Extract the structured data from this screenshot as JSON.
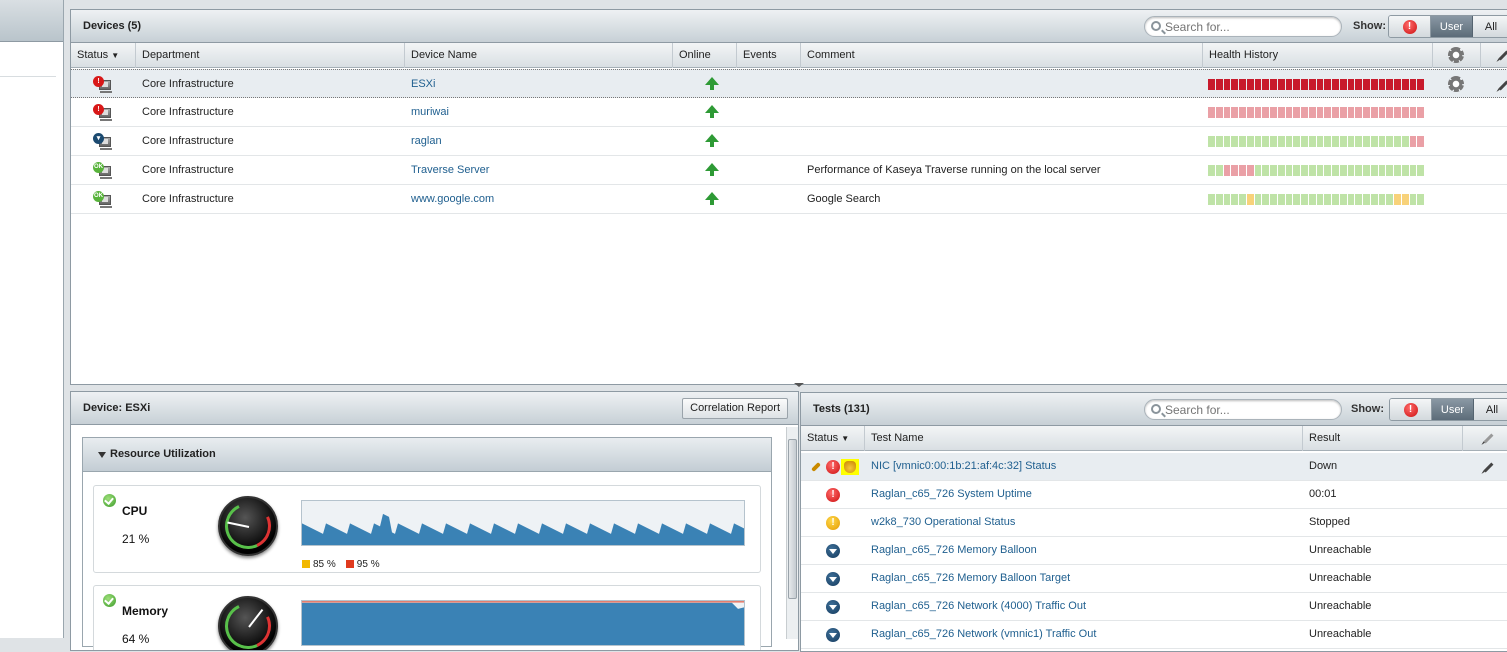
{
  "devices_panel": {
    "title": "Devices (5)",
    "search_placeholder": "Search for...",
    "show_label": "Show:",
    "show_user": "User",
    "show_all": "All",
    "columns": {
      "status": "Status",
      "department": "Department",
      "device_name": "Device Name",
      "online": "Online",
      "events": "Events",
      "comment": "Comment",
      "health_history": "Health History"
    },
    "rows": [
      {
        "status": "critical",
        "department": "Core Infrastructure",
        "device": "ESXi",
        "comment": "",
        "health": "rrrrrrrrrrrrrrrrrrrrrrrrrrrr"
      },
      {
        "status": "critical",
        "department": "Core Infrastructure",
        "device": "muriwai",
        "comment": "",
        "health": "pppppppppppppppppppppppppppp"
      },
      {
        "status": "unreachable",
        "department": "Core Infrastructure",
        "device": "raglan",
        "comment": "",
        "health": "ggggggggggggggggggggggggggpp"
      },
      {
        "status": "ok",
        "department": "Core Infrastructure",
        "device": "Traverse Server",
        "comment": "Performance of Kaseya Traverse running on the local server",
        "health": "ggppppgggggggggggggggggggggg"
      },
      {
        "status": "ok",
        "department": "Core Infrastructure",
        "device": "www.google.com",
        "comment": "Google Search",
        "health": "gggggyggggggggggggggggggyygg"
      }
    ]
  },
  "device_panel": {
    "title": "Device: ESXi",
    "correlation_button": "Correlation Report",
    "resource_title": "Resource Utilization",
    "cpu": {
      "name": "CPU",
      "value": "21 %",
      "fraction": 0.21
    },
    "memory": {
      "name": "Memory",
      "value": "64 %",
      "fraction": 0.64
    },
    "legend_warning": "85 %",
    "legend_critical": "95 %",
    "colors": {
      "warning": "#f2b800",
      "critical": "#e03a1e",
      "spark_fill": "#3a82b5"
    }
  },
  "tests_panel": {
    "title": "Tests (131)",
    "search_placeholder": "Search for...",
    "show_label": "Show:",
    "show_user": "User",
    "show_all": "All",
    "columns": {
      "status": "Status",
      "test_name": "Test Name",
      "result": "Result"
    },
    "rows": [
      {
        "status": "critical",
        "name": "NIC [vmnic0:00:1b:21:af:4c:32] Status",
        "result": "Down"
      },
      {
        "status": "critical",
        "name": "Raglan_c65_726 System Uptime",
        "result": "00:01"
      },
      {
        "status": "warning",
        "name": "w2k8_730 Operational Status",
        "result": "Stopped"
      },
      {
        "status": "unreachable",
        "name": "Raglan_c65_726 Memory Balloon",
        "result": "Unreachable"
      },
      {
        "status": "unreachable",
        "name": "Raglan_c65_726 Memory Balloon Target",
        "result": "Unreachable"
      },
      {
        "status": "unreachable",
        "name": "Raglan_c65_726 Network (4000) Traffic Out",
        "result": "Unreachable"
      },
      {
        "status": "unreachable",
        "name": "Raglan_c65_726 Network (vmnic1) Traffic Out",
        "result": "Unreachable"
      }
    ]
  }
}
